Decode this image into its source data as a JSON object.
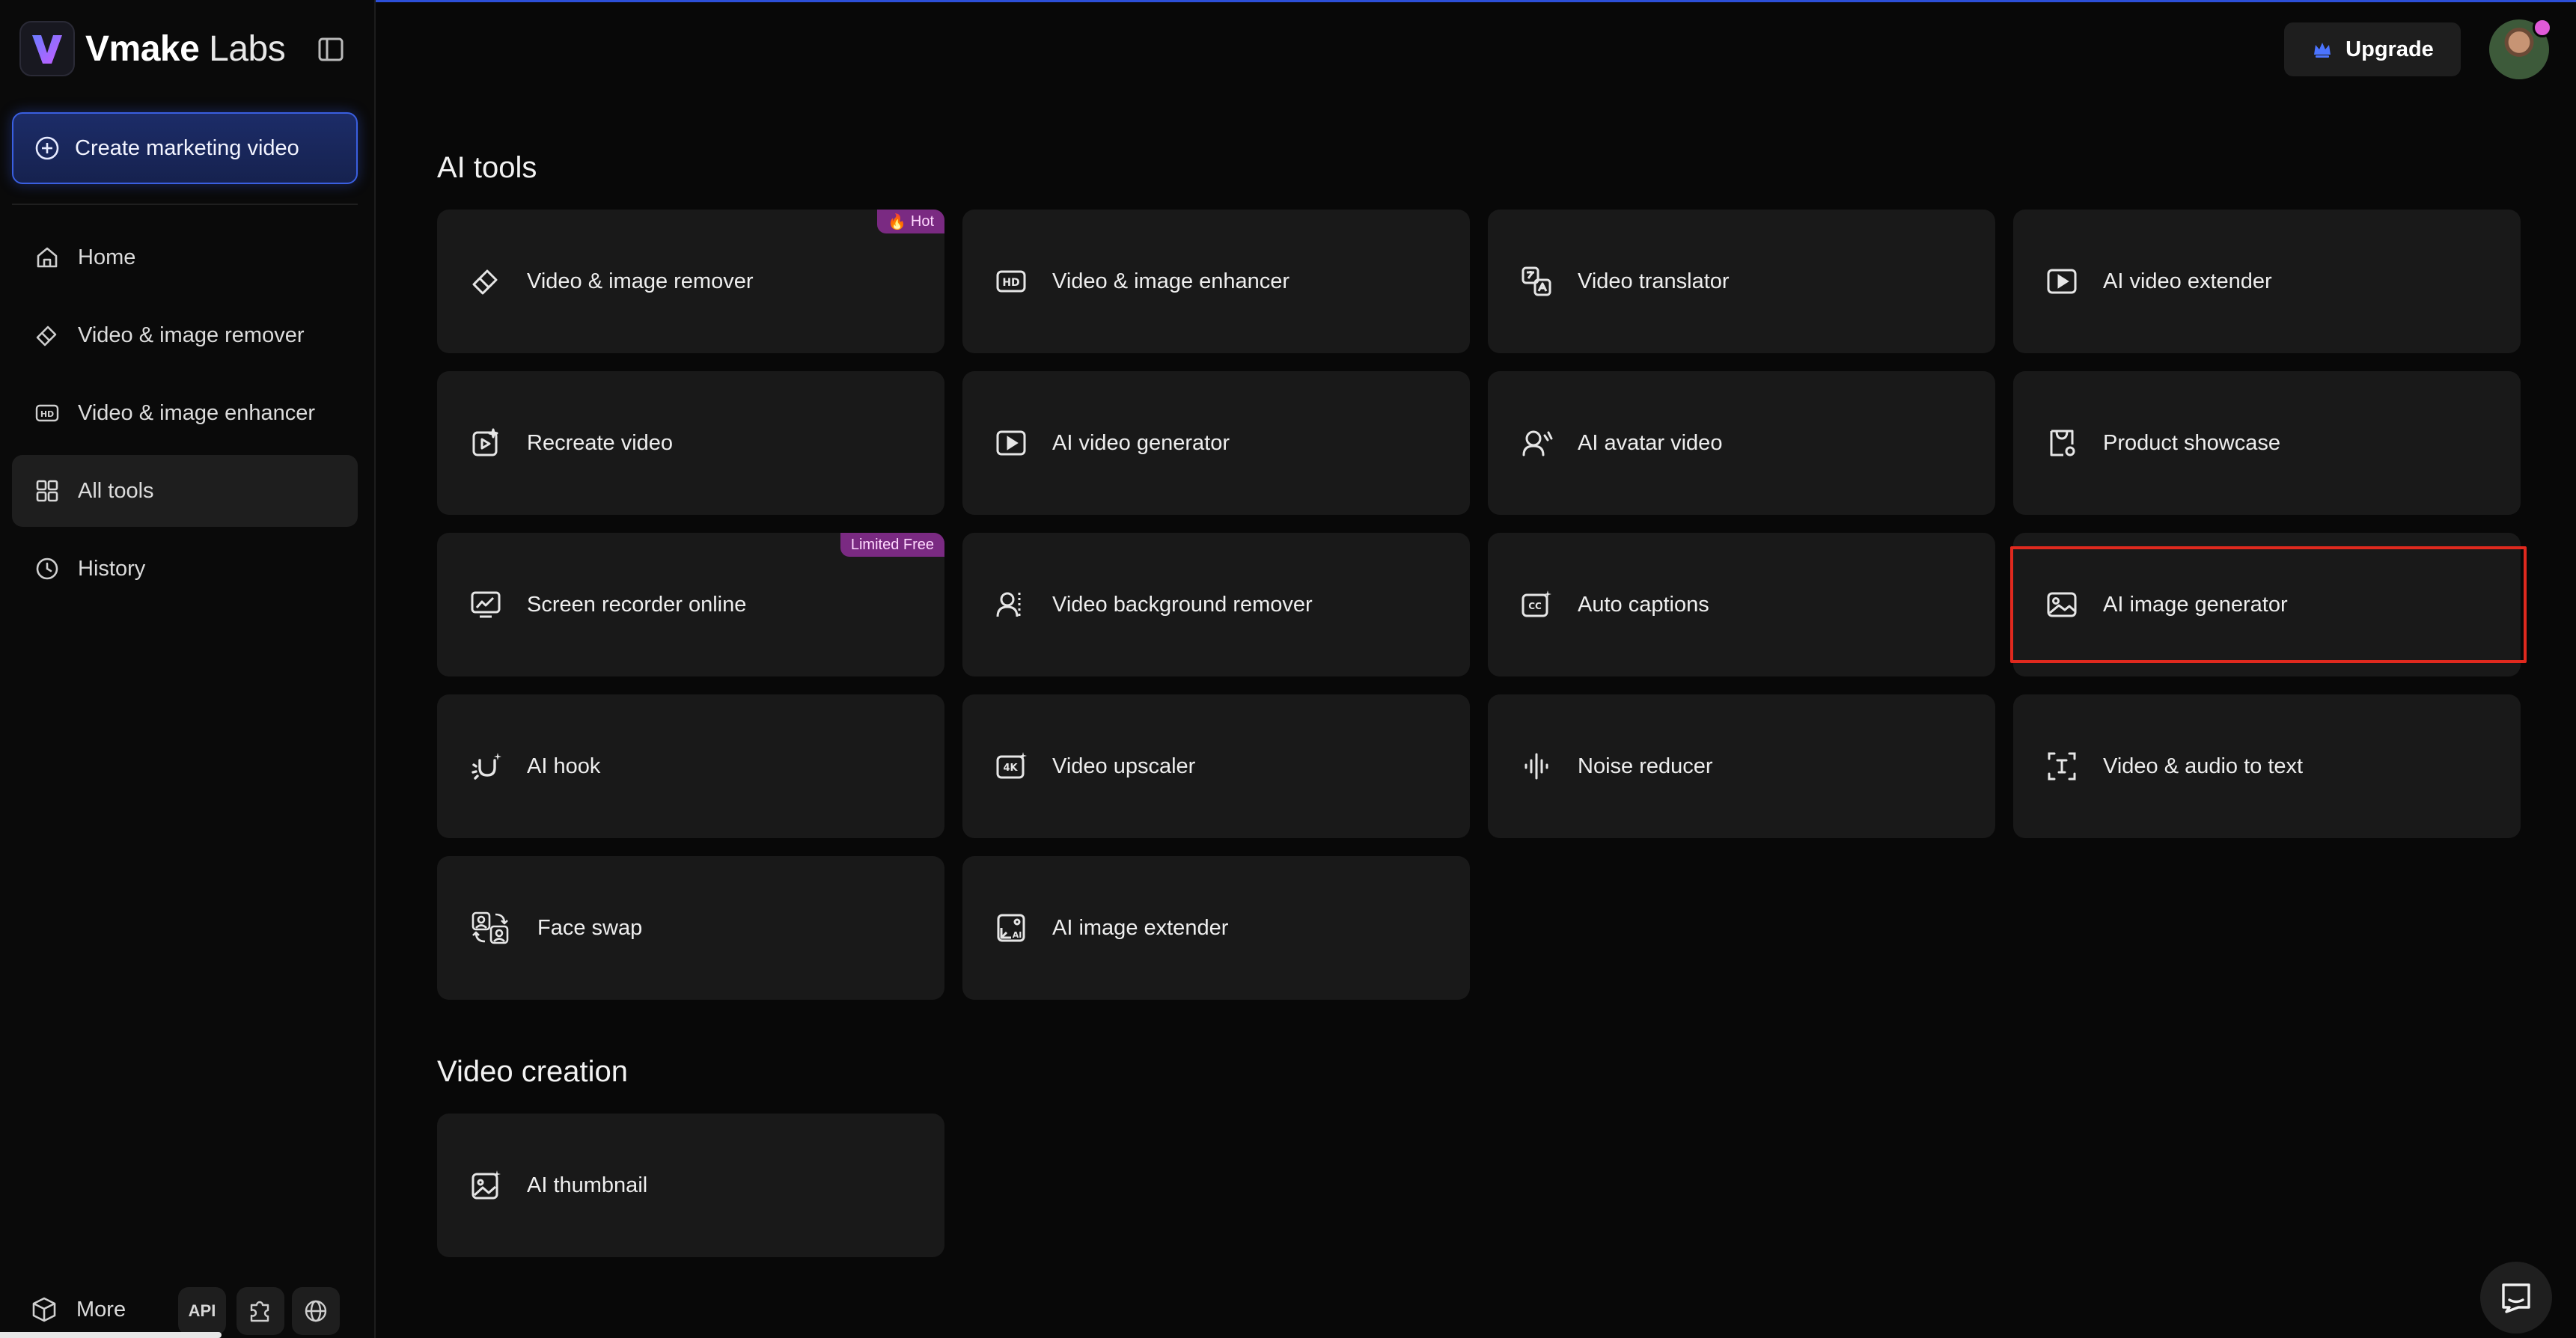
{
  "brand": {
    "name_bold": "Vmake",
    "name_light": "Labs"
  },
  "sidebar": {
    "create_label": "Create marketing video",
    "items": [
      {
        "label": "Home",
        "icon": "home-icon"
      },
      {
        "label": "Video & image remover",
        "icon": "eraser-icon"
      },
      {
        "label": "Video & image enhancer",
        "icon": "hd-icon"
      },
      {
        "label": "All tools",
        "icon": "grid-icon",
        "active": true
      },
      {
        "label": "History",
        "icon": "clock-icon"
      }
    ],
    "more_label": "More",
    "api_label": "API"
  },
  "header": {
    "upgrade_label": "Upgrade"
  },
  "ai_tools": {
    "title": "AI tools",
    "cards": [
      {
        "label": "Video & image remover",
        "icon": "eraser-icon",
        "tag": "Hot"
      },
      {
        "label": "Video & image enhancer",
        "icon": "hd-icon"
      },
      {
        "label": "Video translator",
        "icon": "translate-icon"
      },
      {
        "label": "AI video extender",
        "icon": "play-box-icon"
      },
      {
        "label": "Recreate video",
        "icon": "recreate-icon"
      },
      {
        "label": "AI video generator",
        "icon": "play-box-icon"
      },
      {
        "label": "AI avatar video",
        "icon": "avatar-speak-icon"
      },
      {
        "label": "Product showcase",
        "icon": "product-icon"
      },
      {
        "label": "Screen recorder online",
        "icon": "screen-recorder-icon",
        "tag": "Limited Free"
      },
      {
        "label": "Video background remover",
        "icon": "person-cutout-icon"
      },
      {
        "label": "Auto captions",
        "icon": "cc-icon"
      },
      {
        "label": "AI image generator",
        "icon": "image-icon"
      },
      {
        "label": "AI hook",
        "icon": "magnet-icon"
      },
      {
        "label": "Video upscaler",
        "icon": "4k-icon"
      },
      {
        "label": "Noise reducer",
        "icon": "waveform-icon"
      },
      {
        "label": "Video & audio to text",
        "icon": "text-cursor-icon"
      },
      {
        "label": "Face swap",
        "icon": "face-swap-icon"
      },
      {
        "label": "AI image extender",
        "icon": "image-extend-icon"
      }
    ]
  },
  "video_creation": {
    "title": "Video creation",
    "cards": [
      {
        "label": "AI thumbnail",
        "icon": "thumbnail-icon"
      }
    ]
  },
  "colors": {
    "accent": "#3a5fe0",
    "tag": "#7a2a82",
    "highlight": "#e0291e",
    "card": "#191919"
  }
}
